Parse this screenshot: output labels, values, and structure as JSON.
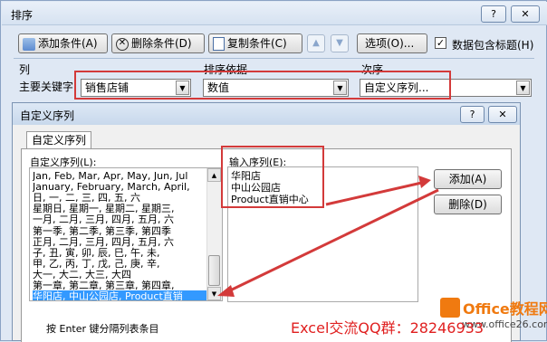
{
  "outer": {
    "title": "排序",
    "help_label": "?",
    "close_label": "✕",
    "toolbar": {
      "add_label": "添加条件(A)",
      "delete_label": "删除条件(D)",
      "copy_label": "复制条件(C)",
      "options_label": "选项(O)...",
      "header_check_label": "数据包含标题(H)",
      "header_checked": true
    },
    "headers": {
      "col": "列",
      "sort_on": "排序依据",
      "order": "次序"
    },
    "row": {
      "label": "主要关键字",
      "column_value": "销售店铺",
      "sort_on_value": "数值",
      "order_value": "自定义序列..."
    }
  },
  "inner": {
    "title": "自定义序列",
    "tab_label": "自定义序列",
    "list_label": "自定义序列(L):",
    "entries_label": "输入序列(E):",
    "list_items": [
      "Jan, Feb, Mar, Apr, May, Jun, Jul",
      "January, February, March, April,",
      "日, 一, 二, 三, 四, 五, 六",
      "星期日, 星期一, 星期二, 星期三,",
      "一月, 二月, 三月, 四月, 五月, 六",
      "第一季, 第二季, 第三季, 第四季",
      "正月, 二月, 三月, 四月, 五月, 六",
      "子, 丑, 寅, 卯, 辰, 巳, 午, 未,",
      "甲, 乙, 丙, 丁, 戊, 己, 庚, 辛,",
      "大一, 大二, 大三, 大四",
      "第一章, 第二章, 第三章, 第四章,",
      "华阳店, 中山公园店, Product直销"
    ],
    "entries": [
      "华阳店",
      "中山公园店",
      "Product直销中心"
    ],
    "add_label": "添加(A)",
    "delete_label": "删除(D)",
    "hint": "按 Enter 键分隔列表条目",
    "help_label": "?",
    "close_label": "✕"
  },
  "watermark": {
    "brand": "Office教程网",
    "url": "www.office26.com",
    "overlay": "Excel交流QQ群：28246933"
  },
  "colors": {
    "annotation_red": "#d33a3a",
    "selection_blue": "#3399ff",
    "watermark_red": "#e02020",
    "brand_orange": "#f07a10"
  }
}
